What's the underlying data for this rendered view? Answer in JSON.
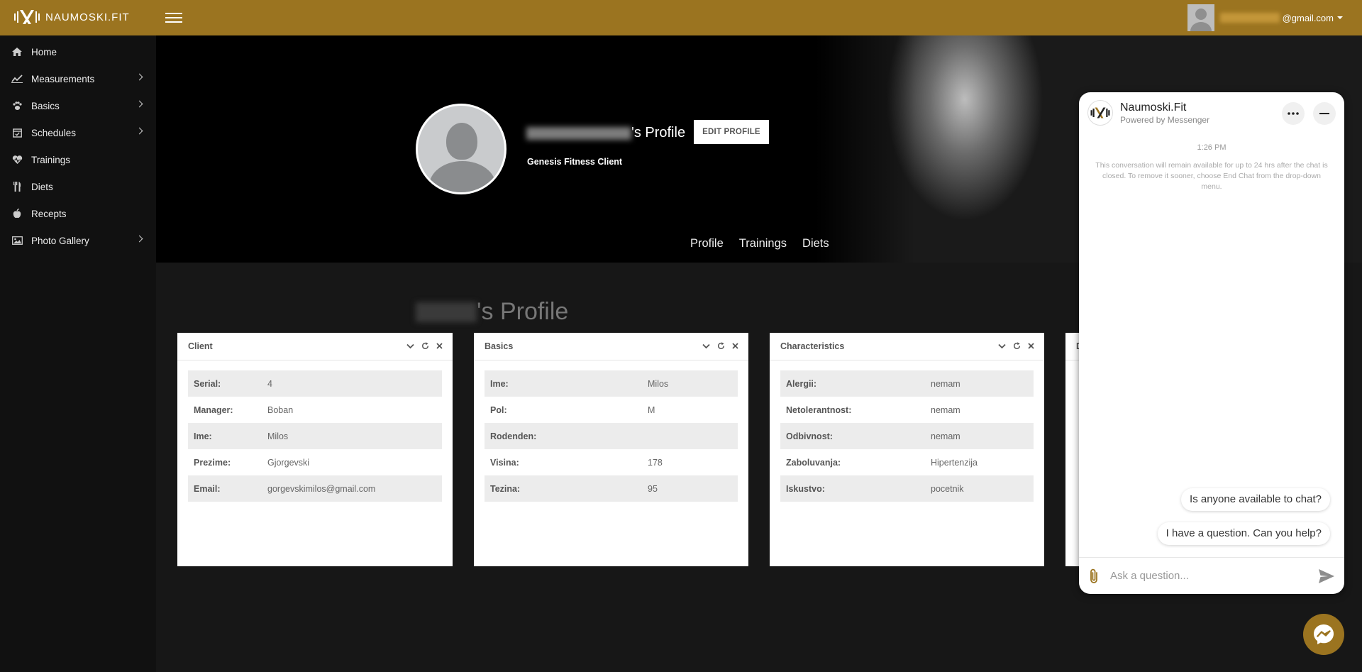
{
  "brand": {
    "name": "NAUMOSKI.FIT"
  },
  "user": {
    "email_suffix": "@gmail.com"
  },
  "sidebar": {
    "items": [
      {
        "label": "Home",
        "icon": "home-icon",
        "has_submenu": false
      },
      {
        "label": "Measurements",
        "icon": "chart-line-icon",
        "has_submenu": true
      },
      {
        "label": "Basics",
        "icon": "paw-icon",
        "has_submenu": true
      },
      {
        "label": "Schedules",
        "icon": "calendar-check-icon",
        "has_submenu": true
      },
      {
        "label": "Trainings",
        "icon": "heartbeat-icon",
        "has_submenu": false
      },
      {
        "label": "Diets",
        "icon": "utensils-icon",
        "has_submenu": false
      },
      {
        "label": "Recepts",
        "icon": "apple-icon",
        "has_submenu": false
      },
      {
        "label": "Photo Gallery",
        "icon": "image-icon",
        "has_submenu": true
      }
    ]
  },
  "hero": {
    "name_suffix": "'s Profile",
    "edit_button": "EDIT PROFILE",
    "subtitle": "Genesis Fitness Client",
    "tabs": [
      "Profile",
      "Trainings",
      "Diets"
    ]
  },
  "page_title": {
    "suffix": "'s Profile"
  },
  "cards": [
    {
      "title": "Client",
      "rows": [
        {
          "key": "Serial:",
          "value": "4"
        },
        {
          "key": "Manager:",
          "value": "Boban"
        },
        {
          "key": "Ime:",
          "value": "Milos"
        },
        {
          "key": "Prezime:",
          "value": "Gjorgevski"
        },
        {
          "key": "Email:",
          "value": "gorgevskimilos@gmail.com"
        }
      ]
    },
    {
      "title": "Basics",
      "rows": [
        {
          "key": "Ime:",
          "value": "Milos"
        },
        {
          "key": "Pol:",
          "value": "M"
        },
        {
          "key": "Rodenden:",
          "value": ""
        },
        {
          "key": "Visina:",
          "value": "178"
        },
        {
          "key": "Tezina:",
          "value": "95"
        }
      ]
    },
    {
      "title": "Characteristics",
      "rows": [
        {
          "key": "Alergii:",
          "value": "nemam"
        },
        {
          "key": "Netolerantnost:",
          "value": "nemam"
        },
        {
          "key": "Odbivnost:",
          "value": "nemam"
        },
        {
          "key": "Zaboluvanja:",
          "value": "Hipertenzija"
        },
        {
          "key": "Iskustvo:",
          "value": "pocetnik"
        }
      ]
    },
    {
      "title": "D",
      "rows": []
    }
  ],
  "chat": {
    "title": "Naumoski.Fit",
    "subtitle": "Powered by Messenger",
    "time": "1:26 PM",
    "notice": "This conversation will remain available for up to 24 hrs after the chat is closed. To remove it sooner, choose End Chat from the drop-down menu.",
    "suggestions": [
      "Is anyone available to chat?",
      "I have a question. Can you help?"
    ],
    "input_placeholder": "Ask a question..."
  },
  "colors": {
    "brand": "#9b7420",
    "sidebar_bg": "#111111",
    "content_bg": "#171717"
  }
}
